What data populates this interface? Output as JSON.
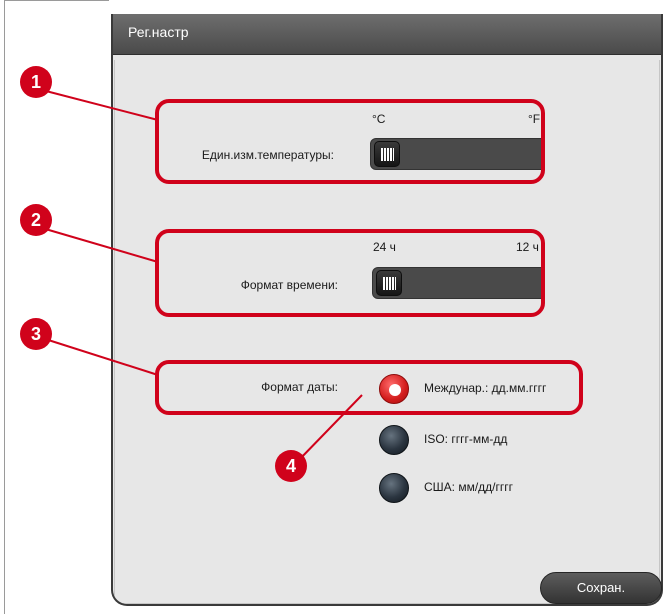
{
  "dialog": {
    "title": "Рег.настр"
  },
  "temperature": {
    "label": "Един.изм.температуры:",
    "option_left": "°C",
    "option_right": "°F",
    "selected": "°C"
  },
  "time": {
    "label": "Формат времени:",
    "option_left": "24 ч",
    "option_right": "12 ч",
    "selected": "24 ч"
  },
  "date": {
    "label": "Формат даты:",
    "options": [
      {
        "label": "Междунар.: дд.мм.гггг",
        "selected": true
      },
      {
        "label": "ISO: гггг-мм-дд",
        "selected": false
      },
      {
        "label": "США: мм/дд/гггг",
        "selected": false
      }
    ]
  },
  "save_button": "Сохран.",
  "callouts": [
    "1",
    "2",
    "3",
    "4"
  ],
  "colors": {
    "accent": "#d0021b",
    "titlebar": "#555555",
    "panel": "#e7e7e7"
  }
}
